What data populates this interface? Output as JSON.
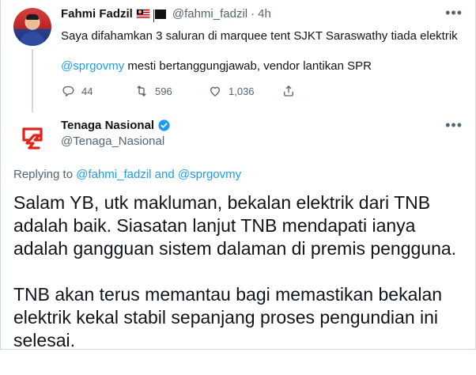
{
  "tweet1": {
    "name": "Fahmi Fadzil",
    "handle": "@fahmi_fadzil",
    "sep": "·",
    "time": "4h",
    "line1": "Saya difahamkan 3 saluran di marquee tent SJKT Saraswathy tiada elektrik",
    "mention": "@sprgovmy",
    "line2_rest": " mesti bertanggungjawab, vendor lantikan SPR",
    "replies": "44",
    "retweets": "596",
    "likes": "1,036"
  },
  "tweet2": {
    "name": "Tenaga Nasional",
    "handle": "@Tenaga_Nasional",
    "replying_prefix": "Replying to ",
    "replying_to_1": "@fahmi_fadzil",
    "replying_and": " and ",
    "replying_to_2": "@sprgovmy",
    "para1": "Salam YB, utk makluman, bekalan elektrik dari TNB adalah baik. Siasatan lanjut TNB mendapati ianya adalah gangguan sistem dalaman di premis pengguna.",
    "para2": "TNB akan terus memantau bagi memastikan bekalan elektrik kekal stabil sepanjang proses pengundian ini selesai."
  },
  "colors": {
    "link": "#1d9bf0",
    "muted": "#536471",
    "tnb_red": "#e2231a"
  }
}
